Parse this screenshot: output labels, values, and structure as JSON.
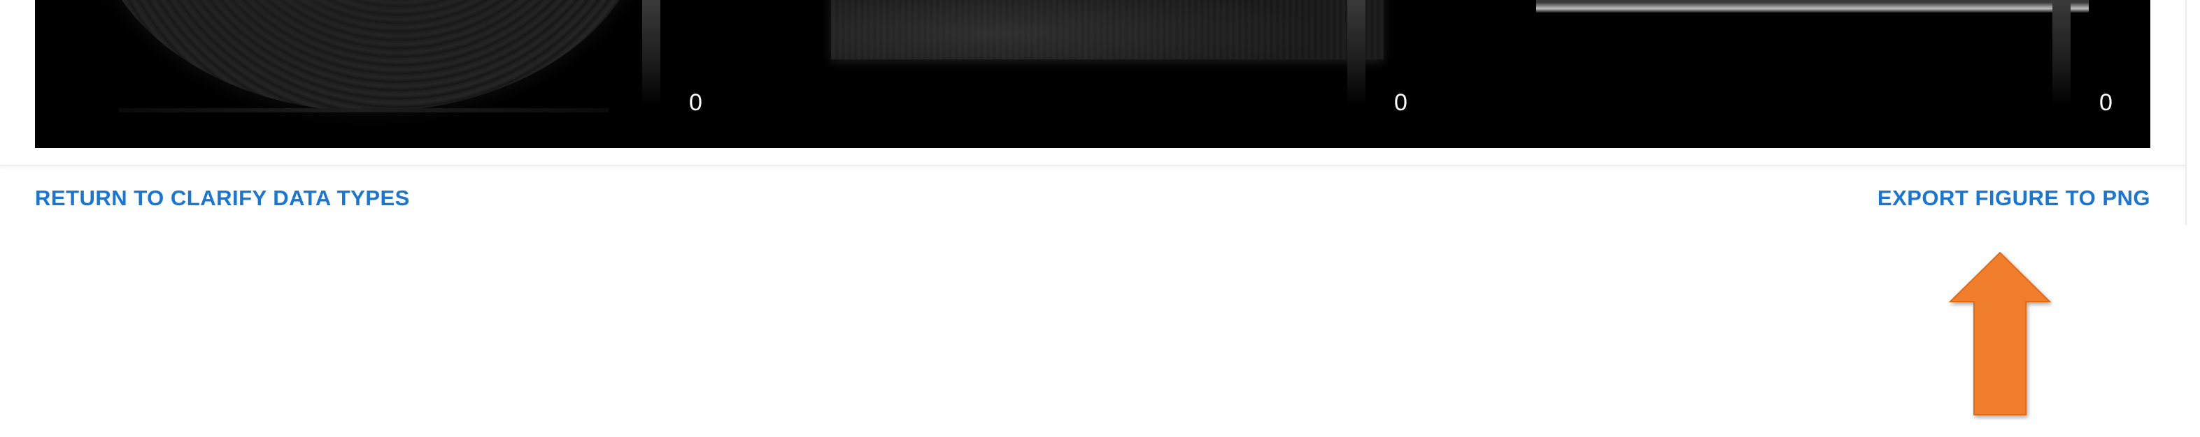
{
  "viewer": {
    "panels": [
      {
        "colorbar_min_label": "0"
      },
      {
        "colorbar_min_label": "0"
      },
      {
        "colorbar_min_label": "0"
      }
    ]
  },
  "actions": {
    "return_label": "RETURN TO CLARIFY DATA TYPES",
    "export_label": "EXPORT FIGURE TO PNG"
  },
  "annotation": {
    "arrow_icon": "up-arrow-icon",
    "arrow_color": "#F07E2C"
  },
  "colors": {
    "link_blue": "#1976D2",
    "viewer_background": "#000000"
  }
}
